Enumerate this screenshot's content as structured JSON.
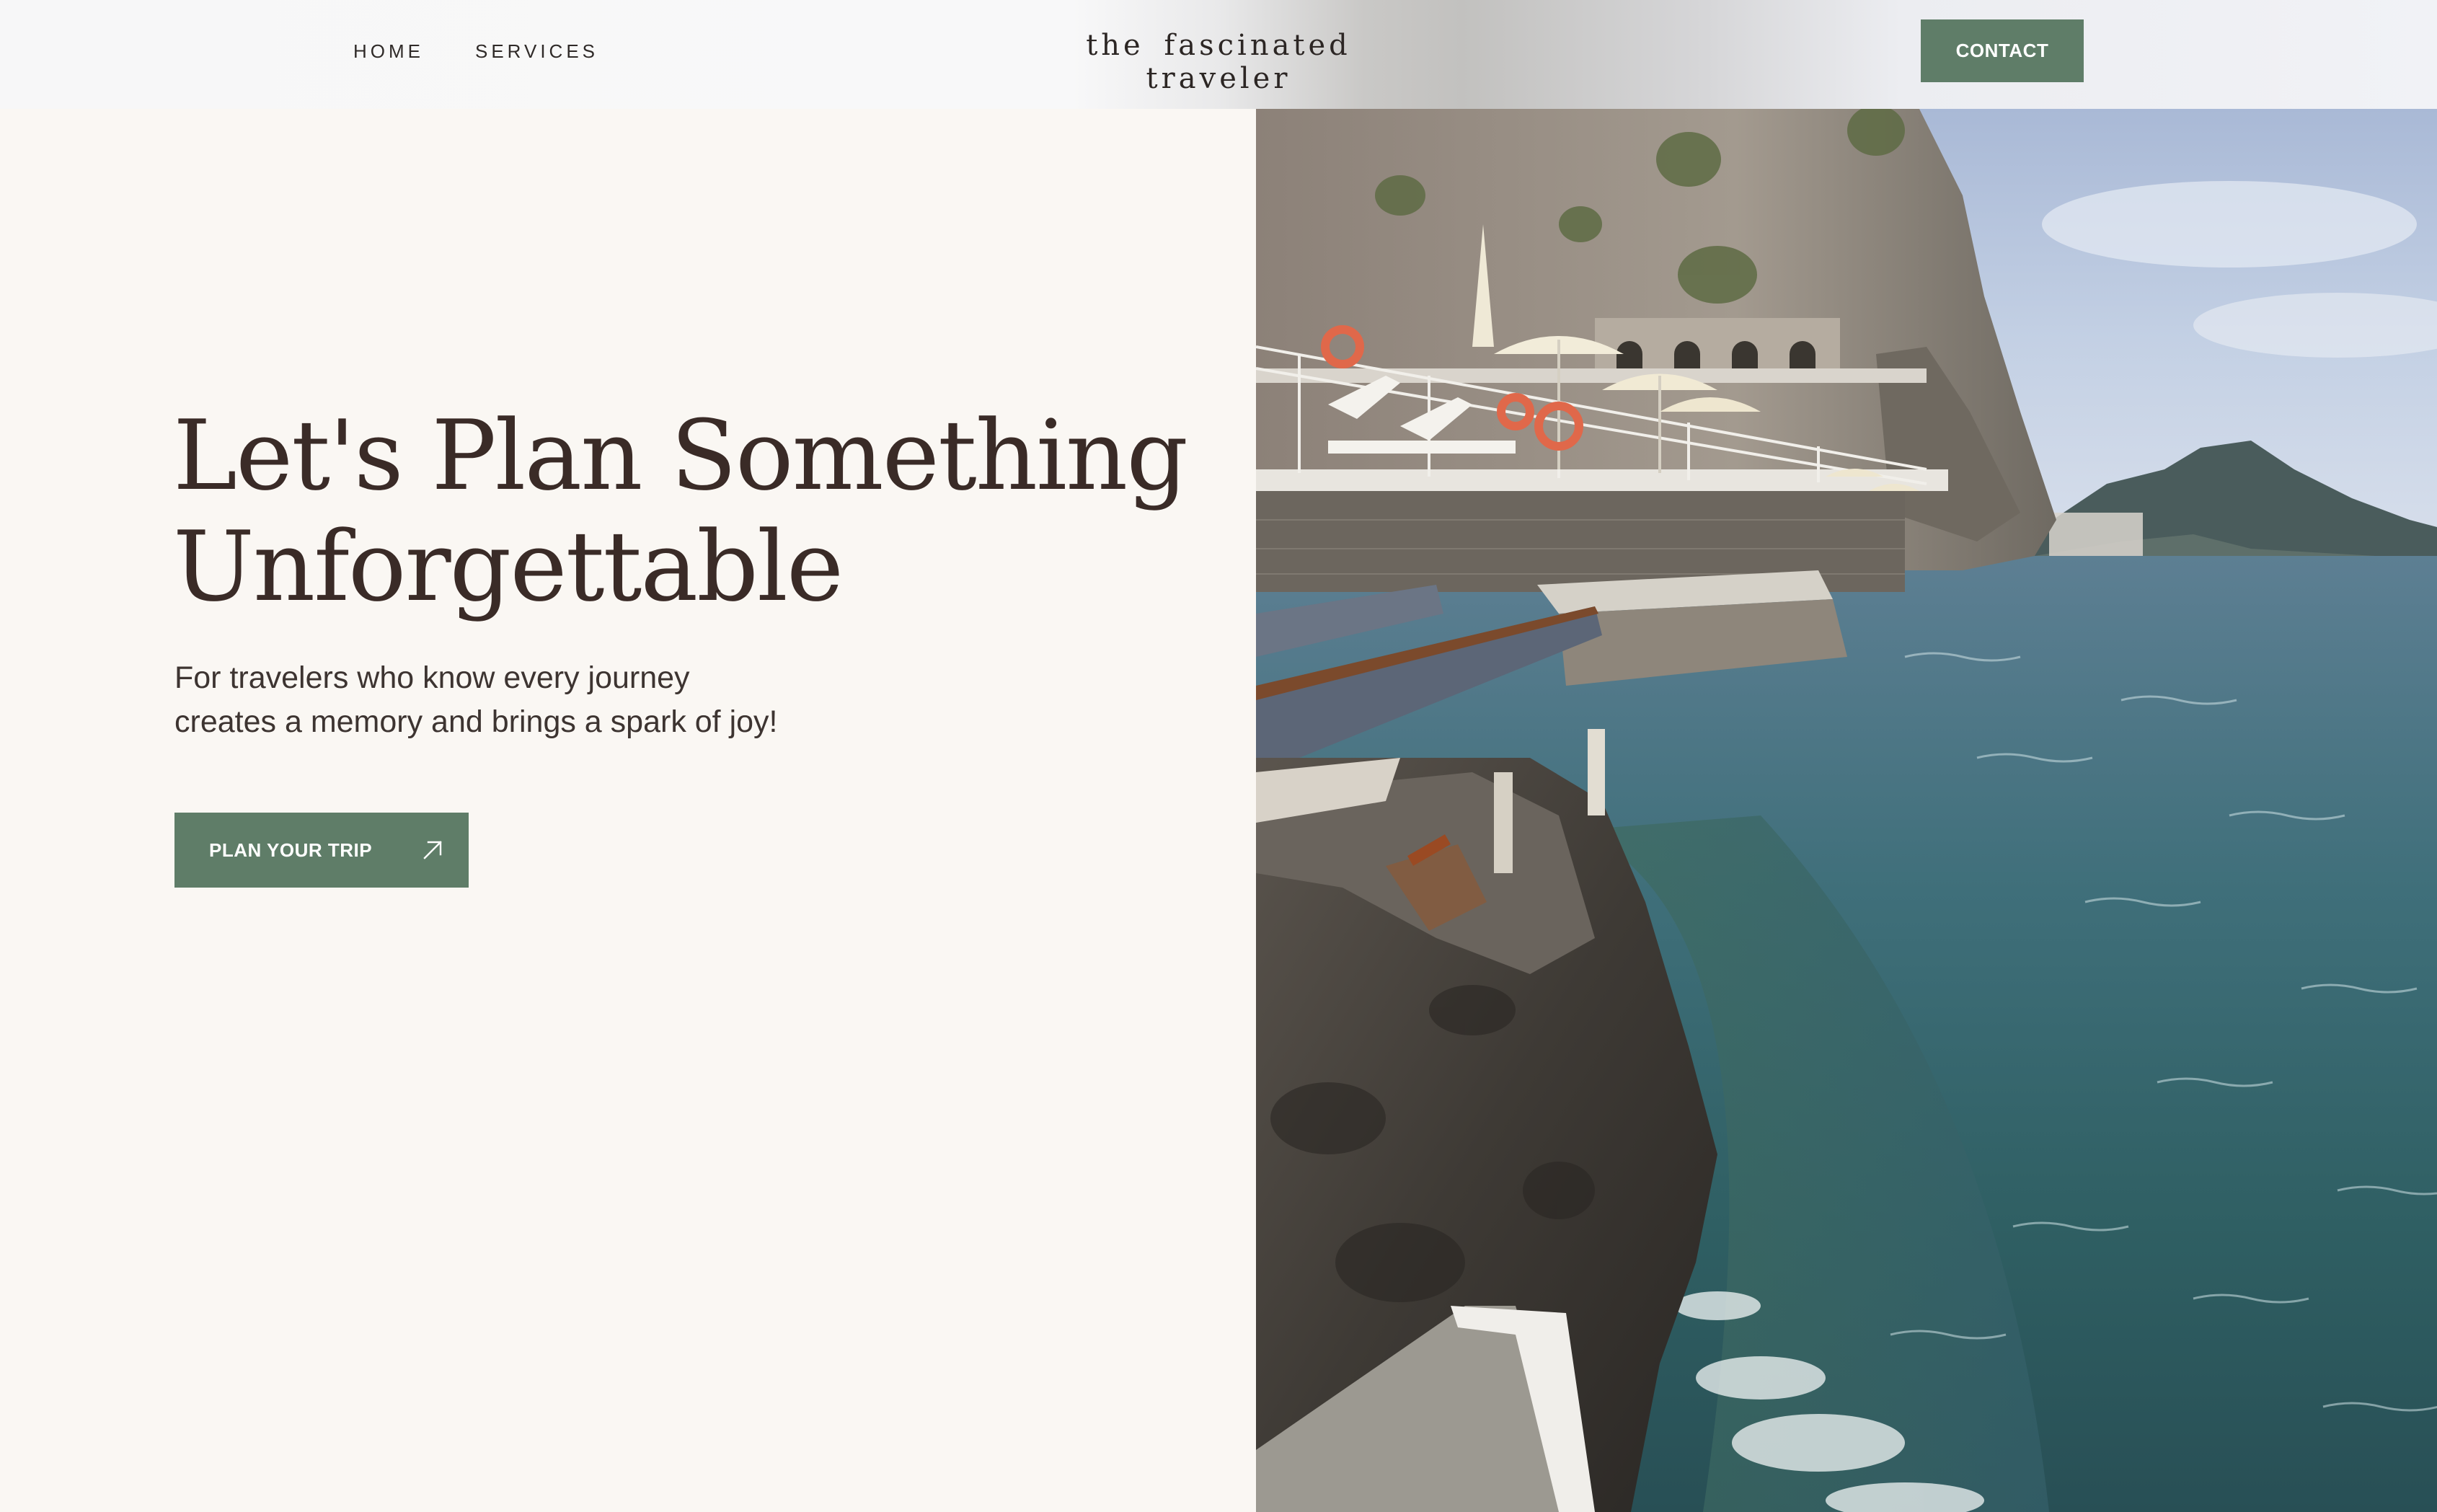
{
  "nav": {
    "home": "HOME",
    "services": "SERVICES"
  },
  "brand": {
    "logo_text": "the fascinated traveler"
  },
  "header": {
    "contact_label": "CONTACT"
  },
  "hero": {
    "headline_line1": "Let's Plan Something",
    "headline_line2": "Unforgettable",
    "subtext_line1": "For travelers who know every journey",
    "subtext_line2": "creates a memory and brings a spark of joy!",
    "cta_label": "PLAN YOUR TRIP",
    "cta_icon": "arrow-up-right-icon",
    "photo_subject": "coastal cliffside beach club with umbrellas above turquoise sea"
  },
  "colors": {
    "accent_green": "#5f7d68",
    "background": "#faf7f3",
    "heading_text": "#3a2b27"
  }
}
